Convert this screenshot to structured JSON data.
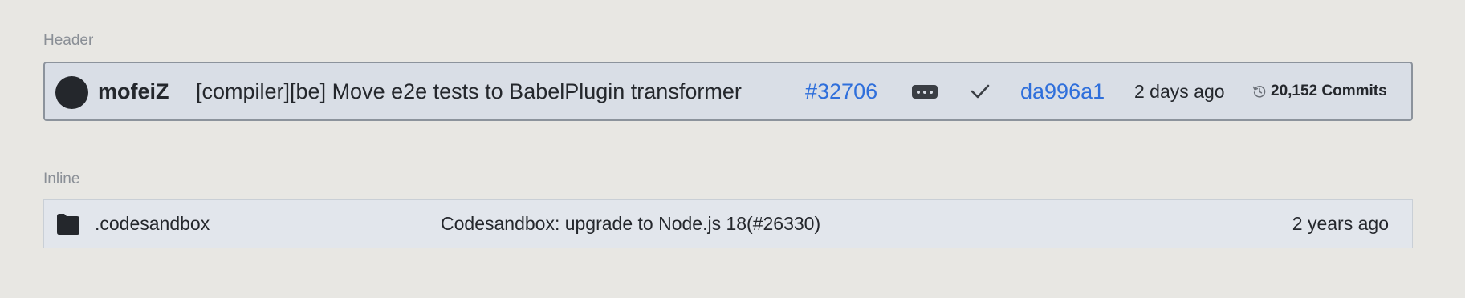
{
  "sections": {
    "header_label": "Header",
    "inline_label": "Inline"
  },
  "header": {
    "author": "mofeiZ",
    "message": "[compiler][be] Move e2e tests to BabelPlugin transformer",
    "pr_number": "#32706",
    "status_icon": "check-icon",
    "sha": "da996a1",
    "time": "2 days ago",
    "commits_label": "20,152 Commits",
    "commits_icon": "history-icon"
  },
  "inline": {
    "icon": "folder-icon",
    "name": ".codesandbox",
    "message": "Codesandbox: upgrade to Node.js 18(#26330)",
    "time": "2 years ago"
  },
  "colors": {
    "background": "#e8e7e3",
    "header_bg": "#d9dee6",
    "link": "#2f6fdb",
    "text": "#24272c"
  }
}
